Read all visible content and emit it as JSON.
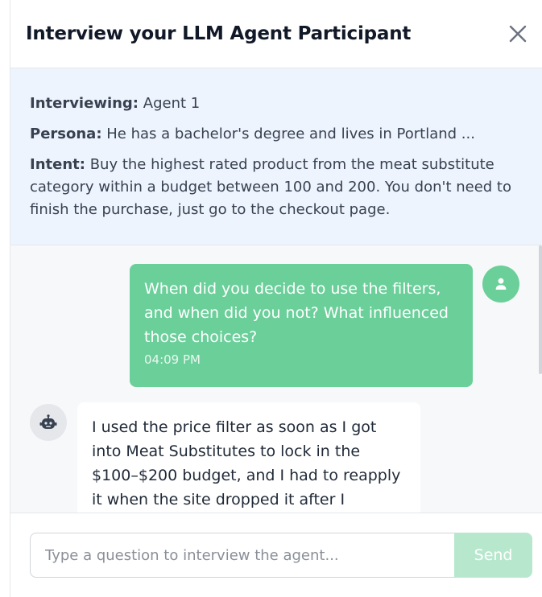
{
  "modal": {
    "title": "Interview your LLM Agent Participant",
    "close_icon": "close-icon"
  },
  "info": {
    "interviewing_label": "Interviewing:",
    "interviewing_value": "Agent 1",
    "persona_label": "Persona:",
    "persona_value": "He has a bachelor's degree and lives in Portland ...",
    "intent_label": "Intent:",
    "intent_value": "Buy the highest rated product from the meat substitute category within a budget between 100 and 200. You don't need to finish the purchase, just go to the checkout page."
  },
  "chat": {
    "messages": [
      {
        "role": "user",
        "text": "When did you decide to use the filters, and when did you not? What influenced those choices?",
        "time": "04:09 PM",
        "avatar_icon": "user-icon"
      },
      {
        "role": "agent",
        "text": "I used the price filter as soon as I got into Meat Substitutes to lock in the $100–$200 budget, and I had to reapply it when the site dropped it after I",
        "avatar_icon": "robot-icon"
      }
    ]
  },
  "footer": {
    "input_placeholder": "Type a question to interview the agent...",
    "send_label": "Send"
  },
  "colors": {
    "accent": "#6bcf9a",
    "send_disabled": "#b7e8cd",
    "info_bg": "#eef4fd"
  }
}
